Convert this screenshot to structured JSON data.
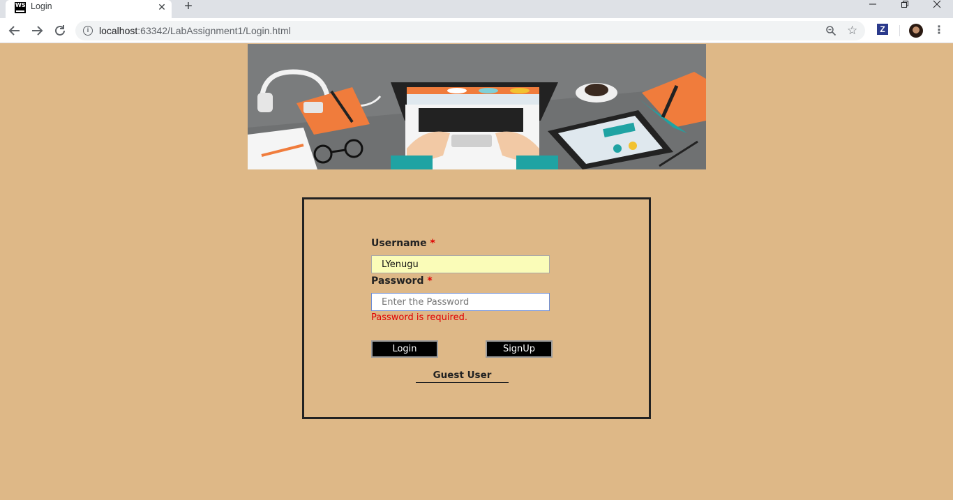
{
  "browser": {
    "tab_title": "Login",
    "tab_favicon_text": "WS",
    "url_host": "localhost",
    "url_rest": ":63342/LabAssignment1/Login.html",
    "extension_letter": "Z"
  },
  "form": {
    "username_label": "Username",
    "password_label": "Password",
    "required_mark": "*",
    "username_value": "LYenugu",
    "password_placeholder": "Enter the Password",
    "password_error": "Password is required.",
    "login_label": "Login",
    "signup_label": "SignUp",
    "guest_label": "Guest User"
  },
  "colors": {
    "page_background": "#deb887",
    "error": "#e00000",
    "button_background": "#000000"
  }
}
